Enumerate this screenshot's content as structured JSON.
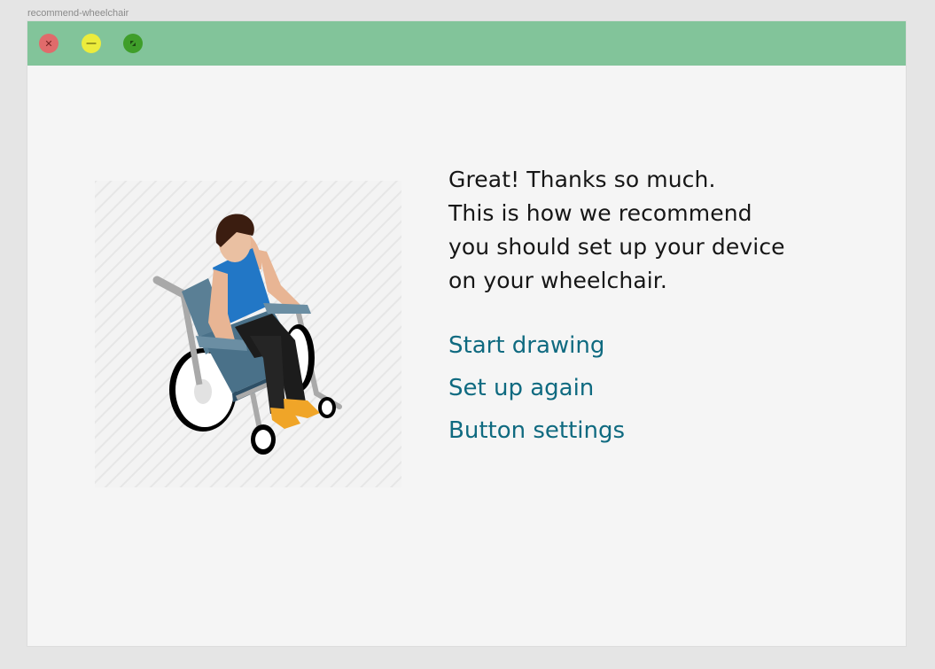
{
  "frame": {
    "label": "recommend-wheelchair"
  },
  "window": {
    "titlebar_color": "#82c49a",
    "controls": {
      "close_icon": "close-icon",
      "minimize_icon": "minimize-icon",
      "maximize_icon": "maximize-icon"
    }
  },
  "illustration": {
    "icon": "person-in-wheelchair-illustration"
  },
  "message": {
    "lines": [
      "Great! Thanks so much.",
      "This is how we recommend",
      "you should set up your device",
      "on your wheelchair."
    ]
  },
  "actions": {
    "start_drawing": "Start drawing",
    "set_up_again": "Set up again",
    "button_settings": "Button settings"
  },
  "colors": {
    "link": "#0f6a80",
    "text": "#161616",
    "background": "#f5f5f5"
  }
}
